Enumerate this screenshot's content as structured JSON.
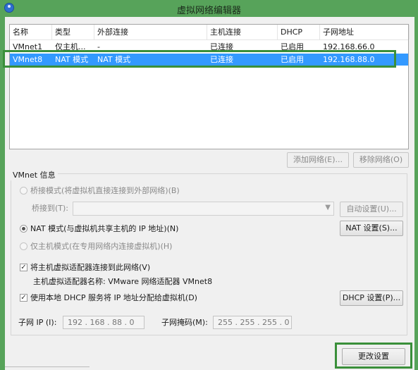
{
  "window": {
    "title": "虚拟网络编辑器"
  },
  "table": {
    "columns": [
      "名称",
      "类型",
      "外部连接",
      "主机连接",
      "DHCP",
      "子网地址"
    ],
    "rows": [
      {
        "name": "VMnet1",
        "type": "仅主机...",
        "external": "-",
        "host": "已连接",
        "dhcp": "已启用",
        "subnet": "192.168.66.0"
      },
      {
        "name": "VMnet8",
        "type": "NAT 模式",
        "external": "NAT 模式",
        "host": "已连接",
        "dhcp": "已启用",
        "subnet": "192.168.88.0"
      }
    ],
    "selected_index": 1
  },
  "table_buttons": {
    "add": "添加网络(E)...",
    "remove": "移除网络(O)"
  },
  "vmnet_info": {
    "label": "VMnet 信息",
    "bridged_label": "桥接模式(将虚拟机直接连接到外部网络)(B)",
    "bridge_to_label": "桥接到(T):",
    "bridge_to_value": "",
    "auto_btn": "自动设置(U)...",
    "nat_label": "NAT 模式(与虚拟机共享主机的 IP 地址)(N)",
    "nat_btn": "NAT 设置(S)...",
    "hostonly_label": "仅主机模式(在专用网络内连接虚拟机)(H)",
    "connect_label": "将主机虚拟适配器连接到此网络(V)",
    "adapter_name": "主机虚拟适配器名称: VMware 网络适配器 VMnet8",
    "dhcp_label": "使用本地 DHCP 服务将 IP 地址分配给虚拟机(D)",
    "dhcp_btn": "DHCP 设置(P)...",
    "subnet_ip_label": "子网 IP (I):",
    "subnet_ip": "192 . 168 . 88  .  0",
    "mask_label": "子网掩码(M):",
    "mask": "255 . 255 . 255 .  0",
    "mode_selected": "nat",
    "connect_checked": true,
    "dhcp_checked": true
  },
  "footer": {
    "apply": "更改设置"
  }
}
